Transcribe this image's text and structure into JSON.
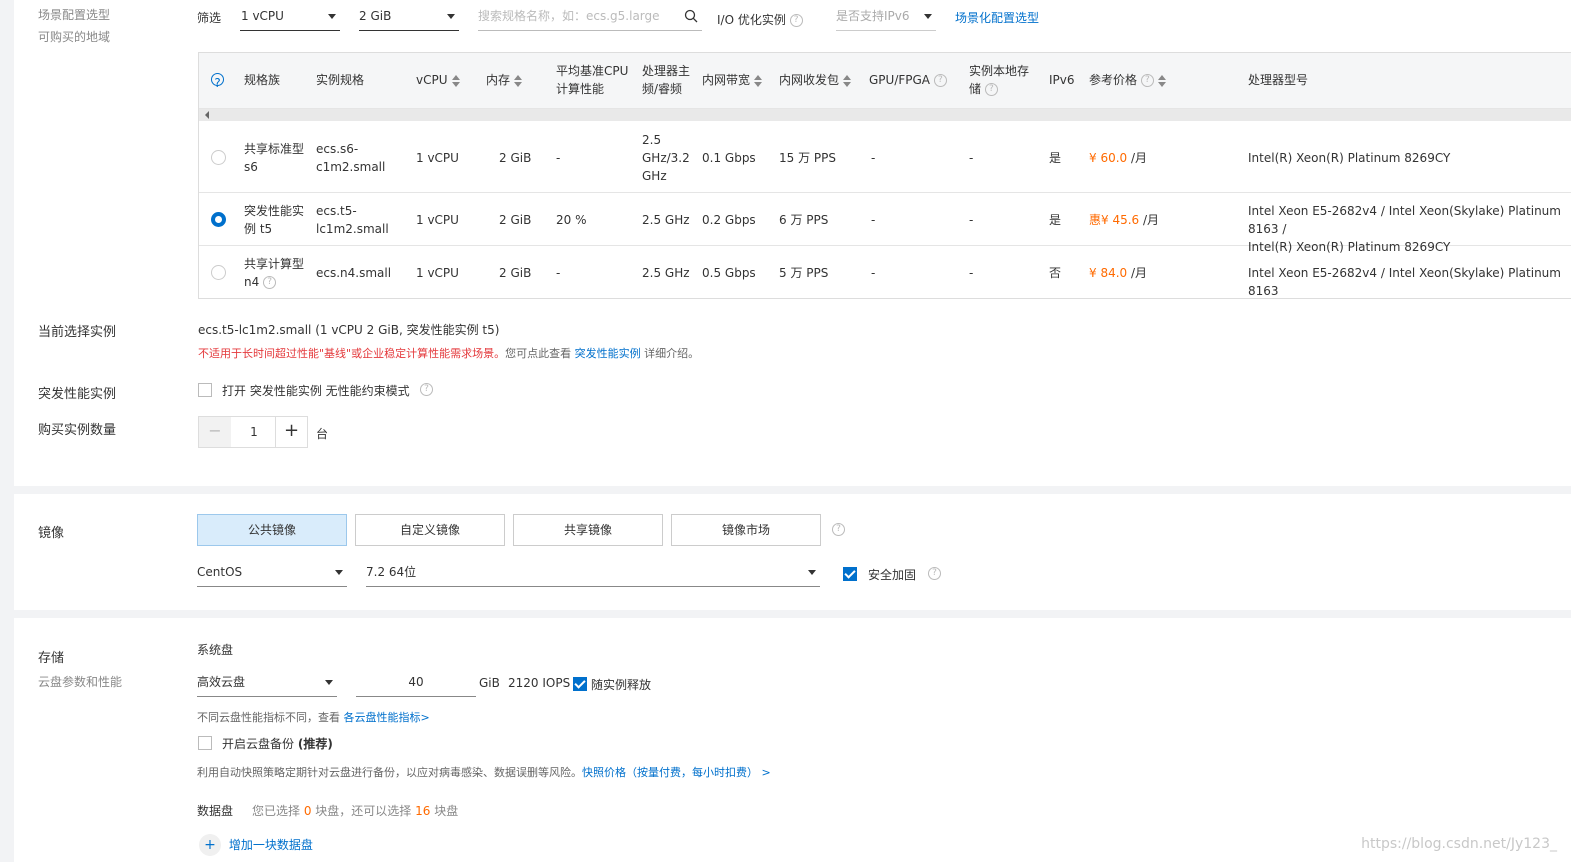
{
  "scene": {
    "title": "场景配置选型",
    "subtitle": "可购买的地域"
  },
  "filter": {
    "label": "筛选",
    "vcpu": "1 vCPU",
    "memory": "2 GiB",
    "search_placeholder": "搜索规格名称，如：ecs.g5.large",
    "io_optimized": "I/O 优化实例",
    "ipv6_placeholder": "是否支持IPv6",
    "scene_link": "场景化配置选型"
  },
  "table": {
    "headers": {
      "family": "规格族",
      "spec": "实例规格",
      "vcpu": "vCPU",
      "memory": "内存",
      "cpu_perf_1": "平均基准CPU",
      "cpu_perf_2": "计算性能",
      "freq_1": "处理器主",
      "freq_2": "频/睿频",
      "bandwidth": "内网带宽",
      "pps": "内网收发包",
      "gpu": "GPU/FPGA",
      "local_1": "实例本地存",
      "local_2": "储",
      "ipv6": "IPv6",
      "price": "参考价格",
      "processor": "处理器型号"
    },
    "rows": [
      {
        "family_1": "共享标准型",
        "family_2": "s6",
        "spec_1": "ecs.s6-",
        "spec_2": "c1m2.small",
        "vcpu": "1 vCPU",
        "memory": "2 GiB",
        "cpu_perf": "-",
        "freq_1": "2.5",
        "freq_2": "GHz/3.2",
        "freq_3": "GHz",
        "bandwidth": "0.1 Gbps",
        "pps": "15 万 PPS",
        "gpu": "-",
        "local": "-",
        "ipv6": "是",
        "price": "¥ 60.0",
        "unit": "/月",
        "processor_1": "Intel(R) Xeon(R) Platinum 8269CY",
        "processor_2": "",
        "selected": false
      },
      {
        "family_1": "突发性能实",
        "family_2": "例 t5",
        "spec_1": "ecs.t5-",
        "spec_2": "lc1m2.small",
        "vcpu": "1 vCPU",
        "memory": "2 GiB",
        "cpu_perf": "20 %",
        "freq_1": "",
        "freq_2": "2.5 GHz",
        "freq_3": "",
        "bandwidth": "0.2 Gbps",
        "pps": "6 万 PPS",
        "gpu": "-",
        "local": "-",
        "ipv6": "是",
        "price": "惠¥ 45.6",
        "unit": "/月",
        "processor_1": "Intel Xeon E5-2682v4 / Intel Xeon(Skylake) Platinum 8163 /",
        "processor_2": "Intel(R) Xeon(R) Platinum 8269CY",
        "selected": true
      },
      {
        "family_1": "共享计算型",
        "family_2": "n4",
        "spec_1": "",
        "spec_2": "ecs.n4.small",
        "vcpu": "1 vCPU",
        "memory": "2 GiB",
        "cpu_perf": "-",
        "freq_1": "",
        "freq_2": "2.5 GHz",
        "freq_3": "",
        "bandwidth": "0.5 Gbps",
        "pps": "5 万 PPS",
        "gpu": "-",
        "local": "-",
        "ipv6": "否",
        "price": "¥ 84.0",
        "unit": "/月",
        "processor_1": "Intel Xeon E5-2682v4 / Intel Xeon(Skylake) Platinum 8163",
        "processor_2": "",
        "selected": false
      }
    ]
  },
  "current": {
    "label": "当前选择实例",
    "value": "ecs.t5-lc1m2.small (1 vCPU 2 GiB, 突发性能实例 t5)",
    "warn": "不适用于长时间超过性能\"基线\"或企业稳定计算性能需求场景。",
    "hint_pre": "您可点此查看 ",
    "hint_link": "突发性能实例",
    "hint_post": " 详细介绍。"
  },
  "burst": {
    "label": "突发性能实例",
    "checkbox_label": "打开 突发性能实例 无性能约束模式"
  },
  "quantity": {
    "label": "购买实例数量",
    "value": "1",
    "unit": "台",
    "minus": "−",
    "plus": "+"
  },
  "image": {
    "label": "镜像",
    "tabs": [
      "公共镜像",
      "自定义镜像",
      "共享镜像",
      "镜像市场"
    ],
    "os": "CentOS",
    "version": "7.2 64位",
    "security": "安全加固"
  },
  "storage": {
    "label": "存储",
    "sub": "云盘参数和性能",
    "system_disk": "系统盘",
    "disk_type": "高效云盘",
    "size": "40",
    "unit": "GiB",
    "iops": "2120 IOPS",
    "release": "随实例释放",
    "perf_hint": "不同云盘性能指标不同，查看 ",
    "perf_link": "各云盘性能指标>",
    "backup_label": "开启云盘备份",
    "backup_recommend": "(推荐)",
    "backup_hint": "利用自动快照策略定期针对云盘进行备份，以应对病毒感染、数据误删等风险。",
    "snapshot_link": "快照价格（按量付费，每小时扣费） >",
    "data_disk": "数据盘",
    "data_pre": "您已选择 ",
    "data_count": "0",
    "data_mid": " 块盘，还可以选择 ",
    "data_remain": "16",
    "data_post": " 块盘",
    "add_disk": "增加一块数据盘"
  },
  "watermark": "https://blog.csdn.net/Jy123_",
  "colors": {
    "accent": "#0070cc",
    "price": "#ff6a00",
    "warn": "#e4393c",
    "tab_active": "#d9ecfb"
  }
}
